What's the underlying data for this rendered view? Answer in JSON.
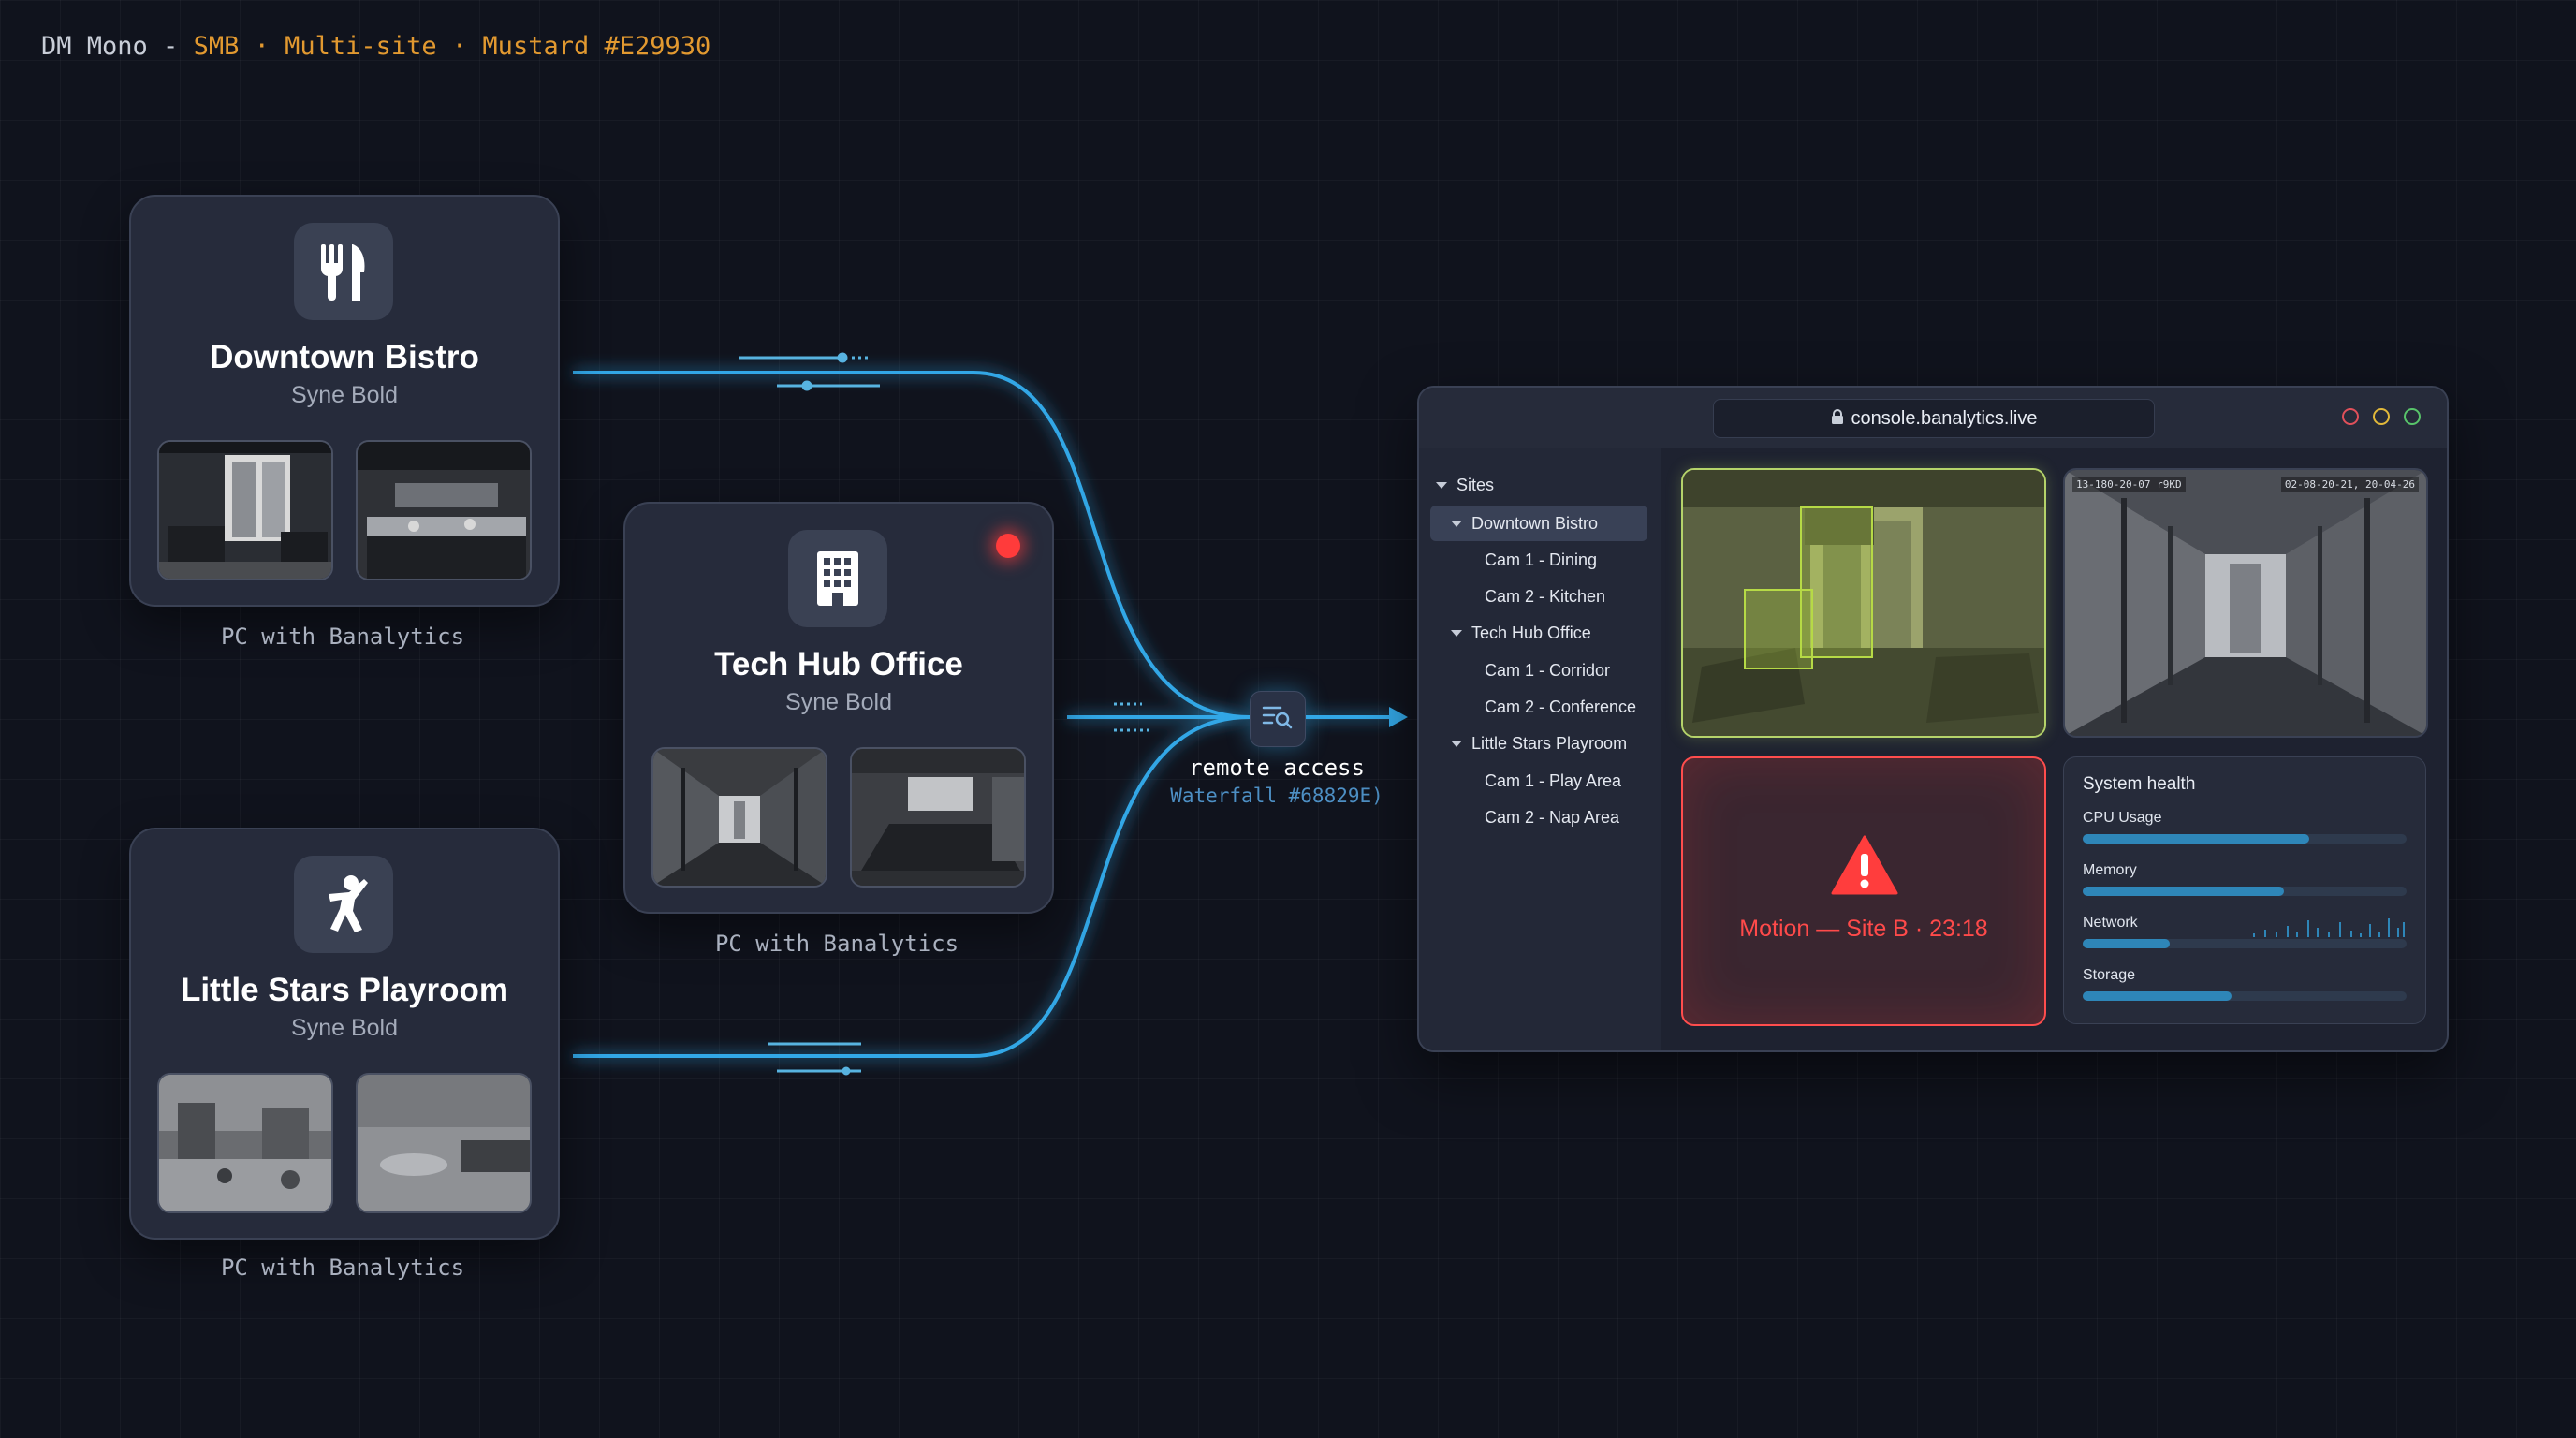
{
  "header": {
    "font_label": "DM Mono -",
    "tags": "SMB · Multi-site · Mustard #E29930",
    "accent_color": "#E29930"
  },
  "sites": [
    {
      "name": "Downtown Bistro",
      "font_note": "Syne Bold",
      "caption": "PC with Banalytics",
      "icon": "utensils-icon"
    },
    {
      "name": "Tech Hub Office",
      "font_note": "Syne Bold",
      "caption": "PC with Banalytics",
      "icon": "building-icon"
    },
    {
      "name": "Little Stars Playroom",
      "font_note": "Syne Bold",
      "caption": "PC with Banalytics",
      "icon": "child-icon"
    }
  ],
  "hub": {
    "label": "remote access",
    "sub": "Waterfall #68829E)",
    "icon": "list-search-icon",
    "line_color": "#3aaee8"
  },
  "console": {
    "url": "console.banalytics.live",
    "lock_icon": "lock-icon",
    "window_controls": [
      "#e0505a",
      "#e2b93a",
      "#58c46a"
    ],
    "sidebar": {
      "root": "Sites",
      "items": [
        {
          "label": "Downtown Bistro",
          "level": 1,
          "expanded": true,
          "selected": true
        },
        {
          "label": "Cam 1 - Dining",
          "level": 2
        },
        {
          "label": "Cam 2 - Kitchen",
          "level": 2
        },
        {
          "label": "Tech Hub Office",
          "level": 1,
          "expanded": true
        },
        {
          "label": "Cam 1 - Corridor",
          "level": 2
        },
        {
          "label": "Cam 2 - Conference",
          "level": 2
        },
        {
          "label": "Little Stars Playroom",
          "level": 1,
          "expanded": true
        },
        {
          "label": "Cam 1 - Play Area",
          "level": 2
        },
        {
          "label": "Cam 2 - Nap Area",
          "level": 2
        }
      ]
    },
    "feed2": {
      "timestamp_left": "13-180-20-07 r9KD",
      "timestamp_right": "02-08-20-21, 20-04-26"
    },
    "alert": {
      "text": "Motion — Site B · 23:18",
      "color": "#ff4a4a"
    },
    "health": {
      "title": "System health",
      "metrics": [
        {
          "label": "CPU Usage",
          "value": 0.7
        },
        {
          "label": "Memory",
          "value": 0.62
        },
        {
          "label": "Network",
          "value": 0.27
        },
        {
          "label": "Storage",
          "value": 0.46
        }
      ]
    }
  }
}
